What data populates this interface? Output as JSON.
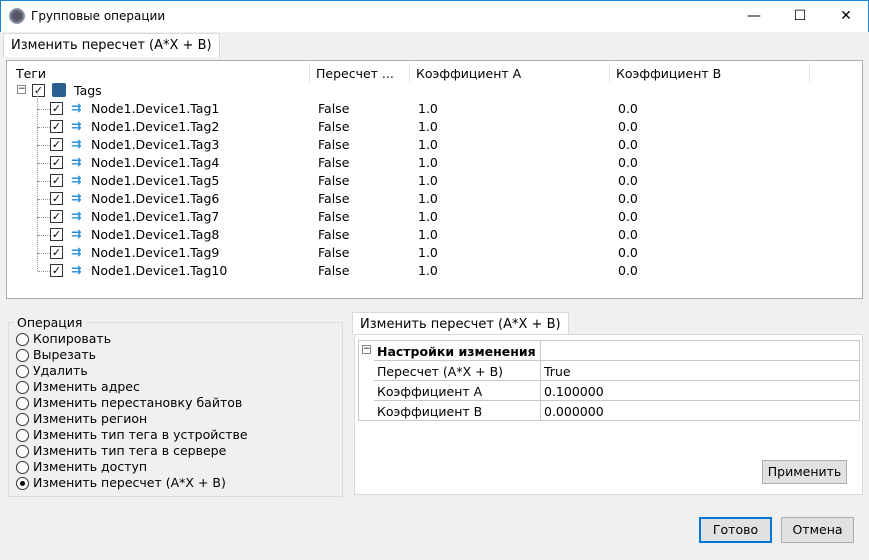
{
  "window": {
    "title": "Групповые операции",
    "minimize": "—",
    "maximize": "☐",
    "close": "✕"
  },
  "top_tab": "Изменить пересчет (A*X + B)",
  "tree": {
    "columns": [
      "Теги",
      "Пересчет ...",
      "Коэффициент A",
      "Коэффициент B"
    ],
    "root": {
      "label": "Tags",
      "checked": true,
      "expanded": true
    },
    "rows": [
      {
        "name": "Node1.Device1.Tag1",
        "recalc": "False",
        "a": "1.0",
        "b": "0.0"
      },
      {
        "name": "Node1.Device1.Tag2",
        "recalc": "False",
        "a": "1.0",
        "b": "0.0"
      },
      {
        "name": "Node1.Device1.Tag3",
        "recalc": "False",
        "a": "1.0",
        "b": "0.0"
      },
      {
        "name": "Node1.Device1.Tag4",
        "recalc": "False",
        "a": "1.0",
        "b": "0.0"
      },
      {
        "name": "Node1.Device1.Tag5",
        "recalc": "False",
        "a": "1.0",
        "b": "0.0"
      },
      {
        "name": "Node1.Device1.Tag6",
        "recalc": "False",
        "a": "1.0",
        "b": "0.0"
      },
      {
        "name": "Node1.Device1.Tag7",
        "recalc": "False",
        "a": "1.0",
        "b": "0.0"
      },
      {
        "name": "Node1.Device1.Tag8",
        "recalc": "False",
        "a": "1.0",
        "b": "0.0"
      },
      {
        "name": "Node1.Device1.Tag9",
        "recalc": "False",
        "a": "1.0",
        "b": "0.0"
      },
      {
        "name": "Node1.Device1.Tag10",
        "recalc": "False",
        "a": "1.0",
        "b": "0.0"
      }
    ]
  },
  "operation": {
    "legend": "Операция",
    "selected": 9,
    "options": [
      "Копировать",
      "Вырезать",
      "Удалить",
      "Изменить адрес",
      "Изменить перестановку байтов",
      "Изменить регион",
      "Изменить тип тега в устройстве",
      "Изменить тип тега в сервере",
      "Изменить доступ",
      "Изменить пересчет (A*X + B)"
    ]
  },
  "settings": {
    "tab": "Изменить пересчет (A*X + B)",
    "category": "Настройки изменения",
    "props": [
      {
        "name": "Пересчет (A*X + B)",
        "value": "True"
      },
      {
        "name": "Коэффициент A",
        "value": "0.100000"
      },
      {
        "name": "Коэффициент B",
        "value": "0.000000"
      }
    ],
    "apply": "Применить"
  },
  "footer": {
    "ok": "Готово",
    "cancel": "Отмена"
  }
}
